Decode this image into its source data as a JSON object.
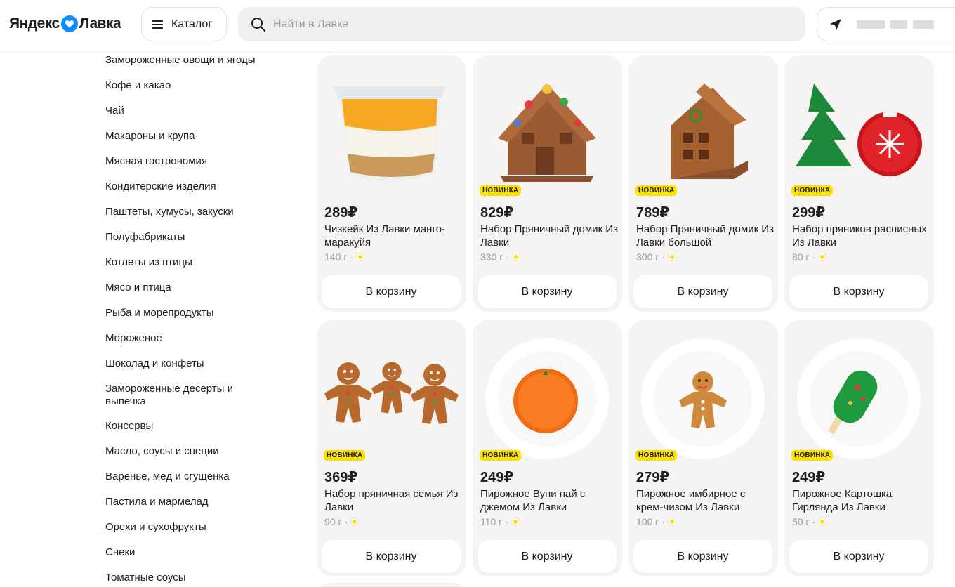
{
  "header": {
    "logo_left": "Яндекс",
    "logo_right": "Лавка",
    "catalog_label": "Каталог",
    "search_placeholder": "Найти в Лавке"
  },
  "sidebar": {
    "categories": [
      "Замороженные овощи и ягоды",
      "Кофе и какао",
      "Чай",
      "Макароны и крупа",
      "Мясная гастрономия",
      "Кондитерские изделия",
      "Паштеты, хумусы, закуски",
      "Полуфабрикаты",
      "Котлеты из птицы",
      "Мясо и птица",
      "Рыба и морепродукты",
      "Мороженое",
      "Шоколад и конфеты",
      "Замороженные десерты и выпечка",
      "Консервы",
      "Масло, соусы и специи",
      "Варенье, мёд и сгущёнка",
      "Пастила и мармелад",
      "Орехи и сухофрукты",
      "Снеки",
      "Томатные соусы"
    ]
  },
  "products": [
    {
      "price": "289₽",
      "name": "Чизкейк Из Лавки манго-маракуйя",
      "weight": "140 г ·",
      "badge": "",
      "cart": "В корзину",
      "image": "cheesecake"
    },
    {
      "price": "829₽",
      "name": "Набор Пряничный домик Из Лавки",
      "weight": "330 г ·",
      "badge": "НОВИНКА",
      "cart": "В корзину",
      "image": "gingerbread-house-candy"
    },
    {
      "price": "789₽",
      "name": "Набор Пряничный домик Из Лавки большой",
      "weight": "300 г ·",
      "badge": "НОВИНКА",
      "cart": "В корзину",
      "image": "gingerbread-house"
    },
    {
      "price": "299₽",
      "name": "Набор пряников расписных Из Лавки",
      "weight": "80 г ·",
      "badge": "НОВИНКА",
      "cart": "В корзину",
      "image": "painted-cookies"
    },
    {
      "price": "369₽",
      "name": "Набор пряничная семья Из Лавки",
      "weight": "90 г ·",
      "badge": "НОВИНКА",
      "cart": "В корзину",
      "image": "gingerbread-family"
    },
    {
      "price": "249₽",
      "name": "Пирожное Вупи пай с джемом Из Лавки",
      "weight": "110 г ·",
      "badge": "НОВИНКА",
      "cart": "В корзину",
      "image": "woopie-pie"
    },
    {
      "price": "279₽",
      "name": "Пирожное имбирное с крем-чизом Из Лавки",
      "weight": "100 г ·",
      "badge": "НОВИНКА",
      "cart": "В корзину",
      "image": "ginger-cake"
    },
    {
      "price": "249₽",
      "name": "Пирожное Картошка Гирлянда Из Лавки",
      "weight": "50 г ·",
      "badge": "НОВИНКА",
      "cart": "В корзину",
      "image": "cake-pop"
    }
  ],
  "colors": {
    "badge": "#fce000",
    "card_bg": "#f5f4f2",
    "search_bg": "#f0efed",
    "logo_blue": "#0f8cff"
  }
}
